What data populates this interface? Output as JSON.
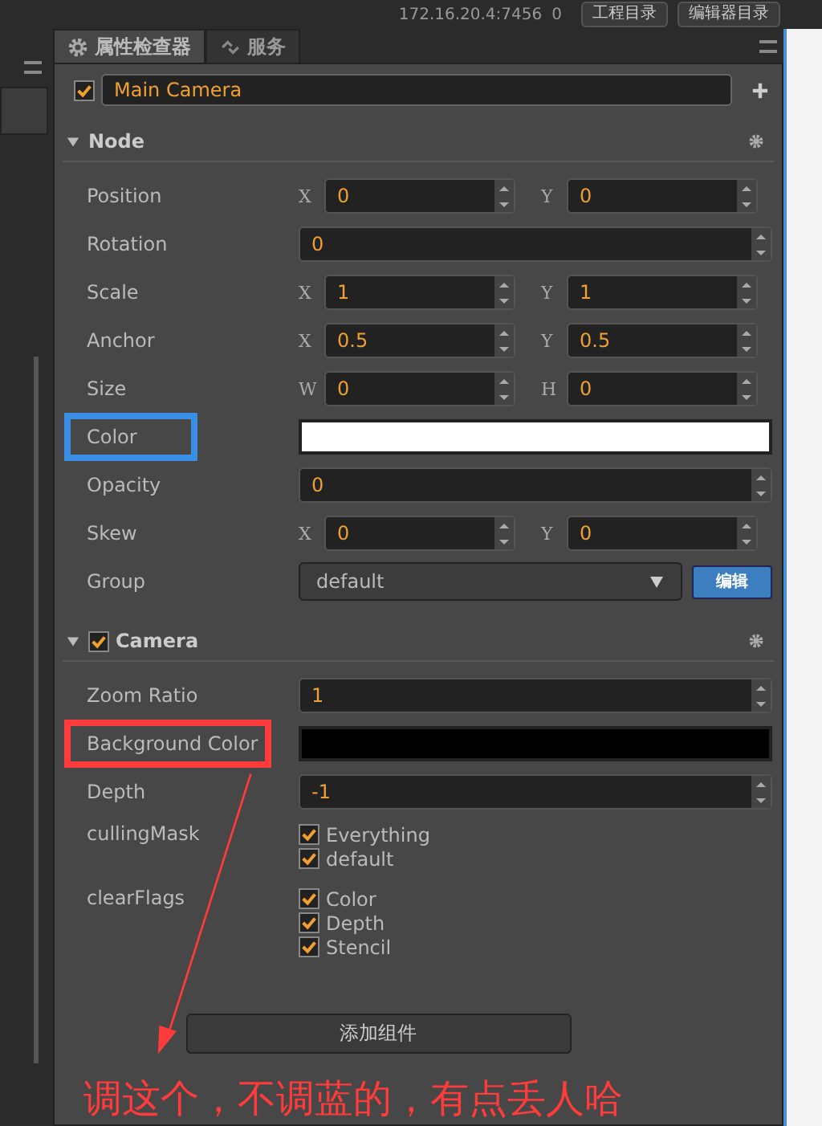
{
  "top_bar": {
    "address": "172.16.20.4:7456",
    "count": "0",
    "buttons": [
      "工程目录",
      "编辑器目录"
    ]
  },
  "tabs": [
    {
      "label": "属性检查器",
      "selected": true
    },
    {
      "label": "服务",
      "selected": false
    }
  ],
  "node": {
    "active": true,
    "name": "Main Camera"
  },
  "sections": [
    {
      "title": "Node",
      "expanded": true,
      "properties": [
        {
          "label": "Position",
          "kind": "vec2",
          "highlighted": false,
          "fields": [
            {
              "axis": "X",
              "value": "0"
            },
            {
              "axis": "Y",
              "value": "0"
            }
          ]
        },
        {
          "label": "Rotation",
          "kind": "number",
          "highlighted": false,
          "value": "0"
        },
        {
          "label": "Scale",
          "kind": "vec2",
          "highlighted": false,
          "fields": [
            {
              "axis": "X",
              "value": "1"
            },
            {
              "axis": "Y",
              "value": "1"
            }
          ]
        },
        {
          "label": "Anchor",
          "kind": "vec2",
          "highlighted": false,
          "fields": [
            {
              "axis": "X",
              "value": "0.5"
            },
            {
              "axis": "Y",
              "value": "0.5"
            }
          ]
        },
        {
          "label": "Size",
          "kind": "vec2",
          "highlighted": false,
          "fields": [
            {
              "axis": "W",
              "value": "0"
            },
            {
              "axis": "H",
              "value": "0"
            }
          ]
        },
        {
          "label": "Color",
          "kind": "color",
          "highlighted": true,
          "color": "#ffffff"
        },
        {
          "label": "Opacity",
          "kind": "number",
          "highlighted": false,
          "value": "0"
        },
        {
          "label": "Skew",
          "kind": "vec2",
          "highlighted": false,
          "fields": [
            {
              "axis": "X",
              "value": "0"
            },
            {
              "axis": "Y",
              "value": "0"
            }
          ]
        },
        {
          "label": "Group",
          "kind": "select",
          "highlighted": false,
          "value": "default",
          "button": "编辑"
        }
      ]
    },
    {
      "title": "Camera",
      "expanded": true,
      "enabled": true,
      "properties": [
        {
          "label": "Zoom Ratio",
          "kind": "number",
          "highlighted": false,
          "value": "1"
        },
        {
          "label": "Background Color",
          "kind": "color",
          "highlighted": true,
          "color": "#000000"
        },
        {
          "label": "Depth",
          "kind": "number",
          "highlighted": false,
          "value": "-1"
        },
        {
          "label": "cullingMask",
          "kind": "checklist",
          "highlighted": false,
          "options": [
            {
              "label": "Everything",
              "checked": true
            },
            {
              "label": "default",
              "checked": true
            }
          ]
        },
        {
          "label": "clearFlags",
          "kind": "checklist",
          "highlighted": false,
          "options": [
            {
              "label": "Color",
              "checked": true
            },
            {
              "label": "Depth",
              "checked": true
            },
            {
              "label": "Stencil",
              "checked": true
            }
          ]
        }
      ]
    }
  ],
  "add_component_button": "添加组件",
  "annotation": {
    "note": "调这个，不调蓝的，有点丢人哈"
  }
}
